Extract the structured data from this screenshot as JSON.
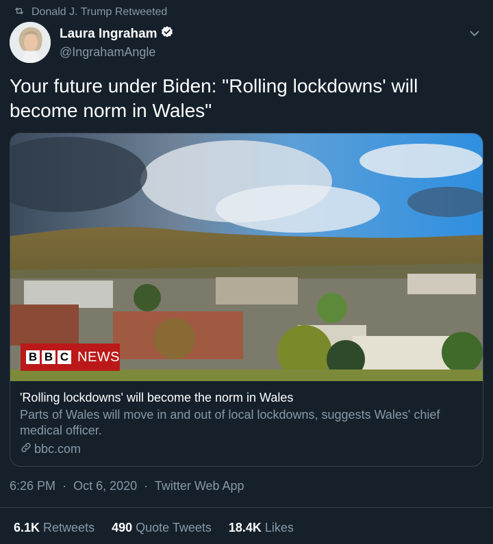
{
  "retweet_header": {
    "text": "Donald J. Trump Retweeted",
    "icon": "retweet-icon"
  },
  "author": {
    "display_name": "Laura Ingraham",
    "handle": "@IngrahamAngle",
    "verified": true,
    "avatar_icon": "avatar"
  },
  "tweet": {
    "text": "Your future under Biden:  \"Rolling lockdowns' will become norm in Wales\""
  },
  "card": {
    "logo_blocks": [
      "B",
      "B",
      "C"
    ],
    "logo_word": "NEWS",
    "title": "'Rolling lockdowns' will become the norm in Wales",
    "description": "Parts of Wales will move in and out of local lockdowns, suggests Wales' chief medical officer.",
    "domain": "bbc.com",
    "domain_icon": "link-icon"
  },
  "meta": {
    "time": "6:26 PM",
    "date": "Oct 6, 2020",
    "source": "Twitter Web App",
    "separator": "·"
  },
  "stats": [
    {
      "count": "6.1K",
      "label": "Retweets"
    },
    {
      "count": "490",
      "label": "Quote Tweets"
    },
    {
      "count": "18.4K",
      "label": "Likes"
    }
  ],
  "colors": {
    "background": "#15202b",
    "secondary_text": "#8899a6",
    "border": "#38444d",
    "verified": "#ffffff",
    "bbc_red": "#bb1919"
  }
}
